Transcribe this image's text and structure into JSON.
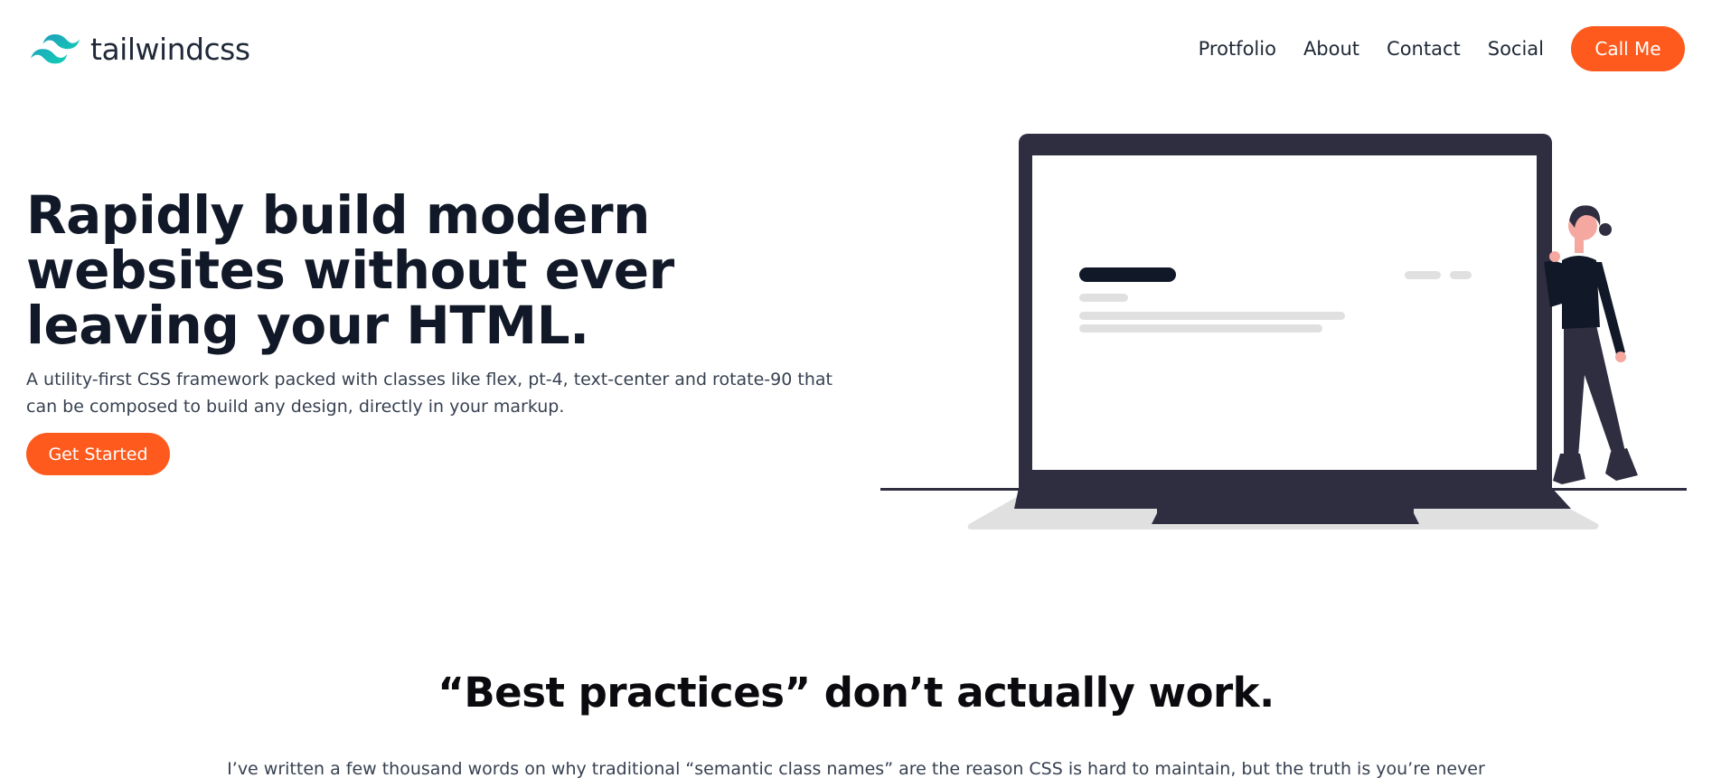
{
  "brand": {
    "name": "tailwindcss",
    "logo_icon": "tailwind-wave-icon",
    "logo_color": "#38bdf8"
  },
  "nav": {
    "items": [
      {
        "label": "Protfolio"
      },
      {
        "label": "About"
      },
      {
        "label": "Contact"
      },
      {
        "label": "Social"
      }
    ],
    "cta_label": "Call Me"
  },
  "hero": {
    "title": "Rapidly build modern websites without ever leaving your HTML.",
    "description": "A utility-first CSS framework packed with classes like flex, pt-4, text-center and rotate-90 that can be composed to build any design, directly in your markup.",
    "button_label": "Get Started",
    "illustration": "person-with-laptop-illustration"
  },
  "section2": {
    "title": "“Best practices” don’t actually work.",
    "text": "I’ve written a few thousand words on why traditional “semantic class names” are the reason CSS is hard to maintain, but the truth is you’re never"
  },
  "colors": {
    "accent": "#fe5a1d",
    "heading": "#111827",
    "laptop": "#2f2e41",
    "logo": "#38bdf8"
  }
}
